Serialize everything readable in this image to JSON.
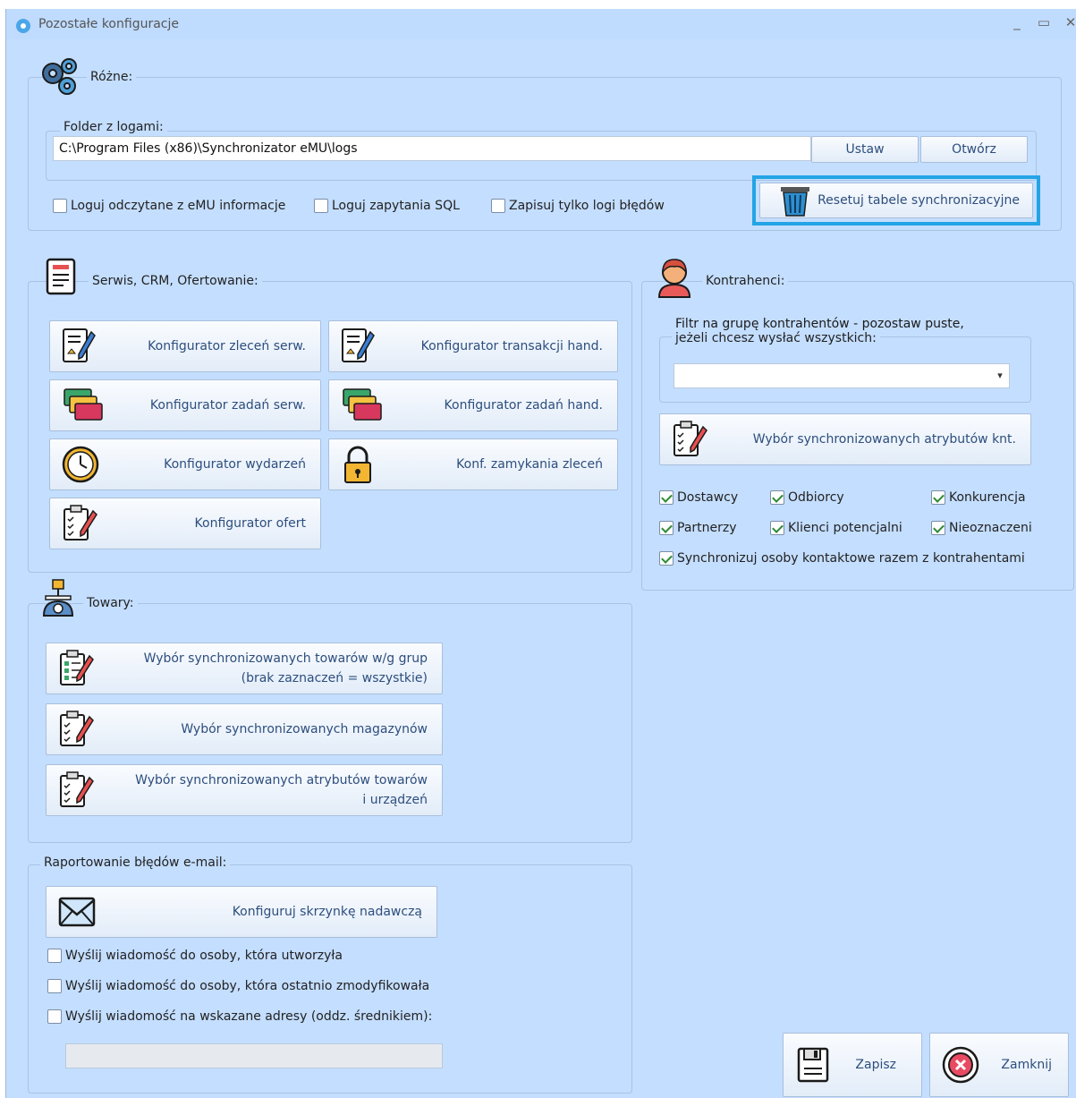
{
  "window": {
    "title": "Pozostałe konfiguracje",
    "min_label": "_",
    "max_label": "▭",
    "close_label": "✕"
  },
  "rozne": {
    "legend": "Różne:",
    "folder_legend": "Folder z logami:",
    "folder_value": "C:\\Program Files (x86)\\Synchronizator eMU\\logs",
    "ustaw": "Ustaw",
    "otworz": "Otwórz",
    "chk_log_emu": "Loguj odczytane z eMU informacje",
    "chk_log_sql": "Loguj zapytania SQL",
    "chk_errors_only": "Zapisuj tylko logi błędów",
    "reset": "Resetuj tabele synchronizacyjne"
  },
  "serwis": {
    "legend": "Serwis, CRM, Ofertowanie:",
    "btn_zlecen": "Konfigurator zleceń serw.",
    "btn_transakcji": "Konfigurator transakcji hand.",
    "btn_zadan_serw": "Konfigurator zadań serw.",
    "btn_zadan_hand": "Konfigurator zadań hand.",
    "btn_wydarzen": "Konfigurator wydarzeń",
    "btn_zamykania": "Konf. zamykania zleceń",
    "btn_ofert": "Konfigurator ofert"
  },
  "kontrahenci": {
    "legend": "Kontrahenci:",
    "filter_line1": "Filtr na grupę kontrahentów - pozostaw puste,",
    "filter_line2": "jeżeli chcesz wysłać wszystkich:",
    "filter_value": "",
    "btn_atrybuty": "Wybór synchronizowanych atrybutów knt.",
    "chk_dostawcy": "Dostawcy",
    "chk_odbiorcy": "Odbiorcy",
    "chk_konkurencja": "Konkurencja",
    "chk_partnerzy": "Partnerzy",
    "chk_klienci": "Klienci potencjalni",
    "chk_nieoznaczeni": "Nieoznaczeni",
    "chk_osoby": "Synchronizuj osoby kontaktowe razem z kontrahentami"
  },
  "towary": {
    "legend": "Towary:",
    "btn_grupy_l1": "Wybór synchronizowanych towarów w/g grup",
    "btn_grupy_l2": "(brak zaznaczeń = wszystkie)",
    "btn_magazyny": "Wybór synchronizowanych magazynów",
    "btn_atr_l1": "Wybór synchronizowanych atrybutów towarów",
    "btn_atr_l2": "i urządzeń"
  },
  "email": {
    "legend": "Raportowanie błędów e-mail:",
    "btn_skrzynka": "Konfiguruj skrzynkę nadawczą",
    "chk_creator": "Wyślij wiadomość do osoby, która utworzyła",
    "chk_modifier": "Wyślij wiadomość do osoby, która ostatnio zmodyfikowała",
    "chk_addresses": "Wyślij wiadomość na wskazane adresy (oddz. średnikiem):",
    "addresses_value": ""
  },
  "footer": {
    "zapisz": "Zapisz",
    "zamknij": "Zamknij"
  }
}
